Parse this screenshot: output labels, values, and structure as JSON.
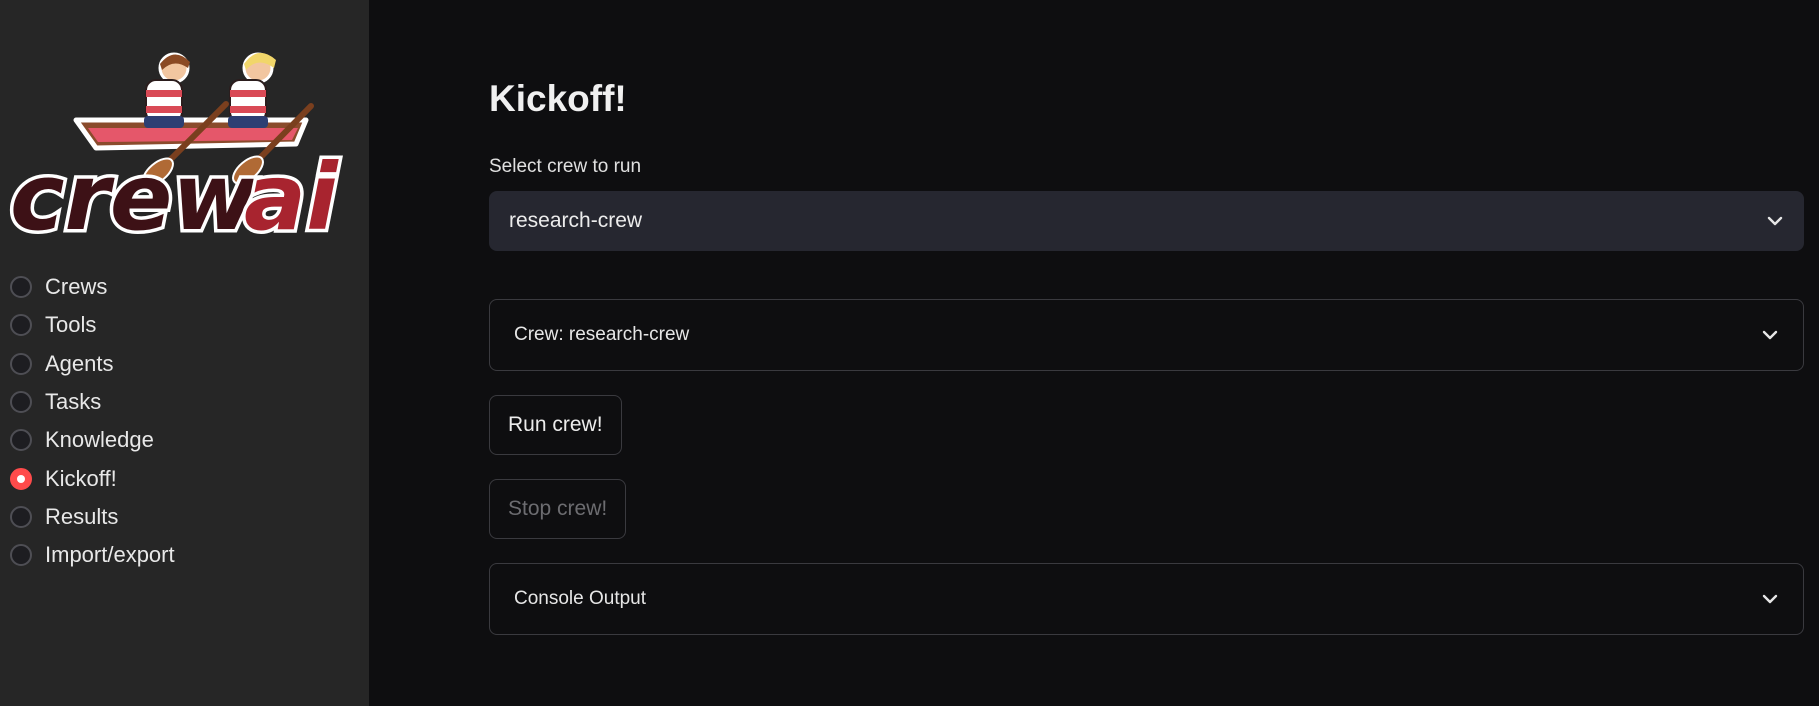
{
  "sidebar": {
    "logo": {
      "text": "crewai",
      "icon": "rowing-boat-logo"
    },
    "nav_items": [
      {
        "label": "Crews",
        "selected": false
      },
      {
        "label": "Tools",
        "selected": false
      },
      {
        "label": "Agents",
        "selected": false
      },
      {
        "label": "Tasks",
        "selected": false
      },
      {
        "label": "Knowledge",
        "selected": false
      },
      {
        "label": "Kickoff!",
        "selected": true
      },
      {
        "label": "Results",
        "selected": false
      },
      {
        "label": "Import/export",
        "selected": false
      }
    ]
  },
  "main": {
    "title": "Kickoff!",
    "select": {
      "label": "Select crew to run",
      "value": "research-crew"
    },
    "crew_expander": {
      "label": "Crew: research-crew",
      "icon": "chevron-down-icon"
    },
    "run_button": {
      "label": "Run crew!"
    },
    "stop_button": {
      "label": "Stop crew!",
      "disabled": true
    },
    "console_expander": {
      "label": "Console Output",
      "icon": "chevron-down-icon"
    }
  },
  "colors": {
    "accent": "#ff4b4b",
    "sidebar_bg": "#262626",
    "main_bg": "#0e0e10",
    "logo_red": "#a8242f"
  }
}
